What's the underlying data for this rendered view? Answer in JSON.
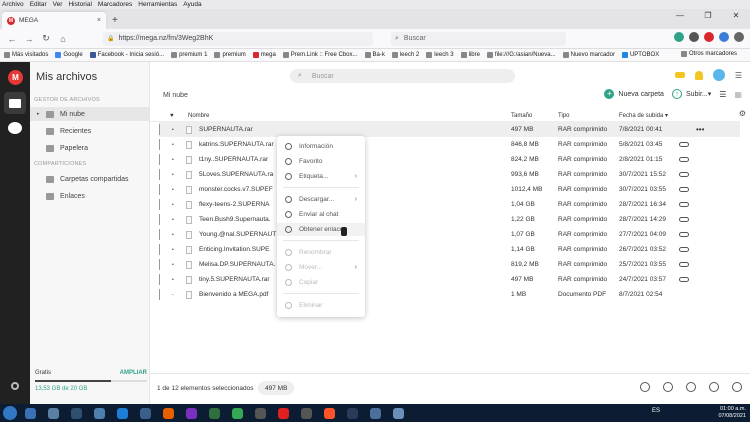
{
  "browser": {
    "menu": [
      "Archivo",
      "Editar",
      "Ver",
      "Historial",
      "Marcadores",
      "Herramientas",
      "Ayuda"
    ],
    "tab": {
      "favicon": "M",
      "title": "MEGA",
      "close": "×"
    },
    "new_tab": "+",
    "window_controls": [
      "—",
      "❐",
      "✕"
    ],
    "url": "https://mega.nz/fm/3Weg2BhK",
    "search_placeholder": "Buscar",
    "bookmarks": [
      "Más visitados",
      "Google",
      "Facebook - Inicia sesió...",
      "premium 1",
      "premium",
      "mega",
      "Prem.Link :: Free Cbox...",
      "Ba-k",
      "leech 2",
      "leech 3",
      "libre",
      "file:///G:/asian/Nueva...",
      "Nuevo marcador",
      "UPTOBOX"
    ],
    "bookmarks_other": "Otros marcadores"
  },
  "app": {
    "logo": "M",
    "title": "Mis archivos",
    "search_placeholder": "Buscar",
    "sidebar": {
      "section_drive": "GESTOR DE ARCHIVOS",
      "items_drive": [
        "Mi nube",
        "Recientes",
        "Papelera"
      ],
      "section_shares": "COMPARTICIONES",
      "items_shares": [
        "Carpetas compartidas",
        "Enlaces"
      ]
    },
    "plan": {
      "label": "Gratis",
      "upgrade": "AMPLIAR",
      "usage": "13,53 GB de 20 GB",
      "used_fraction": 0.68
    },
    "breadcrumb": "Mi nube",
    "actions": {
      "new_folder": "Nueva carpeta",
      "upload": "Subir..."
    },
    "table": {
      "columns": {
        "name": "Nombre",
        "size": "Tamaño",
        "type": "Tipo",
        "date": "Fecha de subida"
      },
      "rows": [
        {
          "name": "SUPERNAUTA.rar",
          "size": "497 MB",
          "type": "RAR comprimido",
          "date": "7/8/2021 00:41"
        },
        {
          "name": "katrins.SUPERNAUTA.rar",
          "size": "846,8 MB",
          "type": "RAR comprimido",
          "date": "5/8/2021 03:45"
        },
        {
          "name": "t1ny..SUPERNAUTA.rar",
          "size": "824,2 MB",
          "type": "RAR comprimido",
          "date": "2/8/2021 01:15"
        },
        {
          "name": "5Loves.SUPERNAUTA.ra",
          "size": "993,6 MB",
          "type": "RAR comprimido",
          "date": "30/7/2021 15:52"
        },
        {
          "name": "monster.cocks.v7.SUPEF",
          "size": "1012,4 MB",
          "type": "RAR comprimido",
          "date": "30/7/2021 03:55"
        },
        {
          "name": "flexy-teens-2.SUPERNA",
          "size": "1,04 GB",
          "type": "RAR comprimido",
          "date": "28/7/2021 16:34"
        },
        {
          "name": "Teen.Bush9.Supernauta.",
          "size": "1,22 GB",
          "type": "RAR comprimido",
          "date": "28/7/2021 14:29"
        },
        {
          "name": "Young.@nal.SUPERNAUT",
          "size": "1,07 GB",
          "type": "RAR comprimido",
          "date": "27/7/2021 04:09"
        },
        {
          "name": "Enticing.Invitation.SUPE",
          "size": "1,14 GB",
          "type": "RAR comprimido",
          "date": "26/7/2021 03:52"
        },
        {
          "name": "Melisa.DP.SUPERNAUTA.",
          "size": "819,2 MB",
          "type": "RAR comprimido",
          "date": "25/7/2021 03:55"
        },
        {
          "name": "tiny.5.SUPERNAUTA.rar",
          "size": "497 MB",
          "type": "RAR comprimido",
          "date": "24/7/2021 03:57"
        },
        {
          "name": "Bienvenido a MEGA.pdf",
          "size": "1 MB",
          "type": "Documento PDF",
          "date": "8/7/2021 02:54"
        }
      ]
    },
    "context_menu": {
      "items": [
        "Información",
        "Favorito",
        "Etiqueta...",
        "Descargar...",
        "Enviar al chat",
        "Obtener enlace",
        "Renombrar",
        "Mover...",
        "Copiar",
        "Eliminar"
      ]
    },
    "status": {
      "selection": "1 de 12 elementos seleccionados",
      "selection_size": "497 MB"
    }
  },
  "taskbar": {
    "lang": "ES",
    "time": "01:00 a.m.",
    "date": "07/08/2021"
  }
}
